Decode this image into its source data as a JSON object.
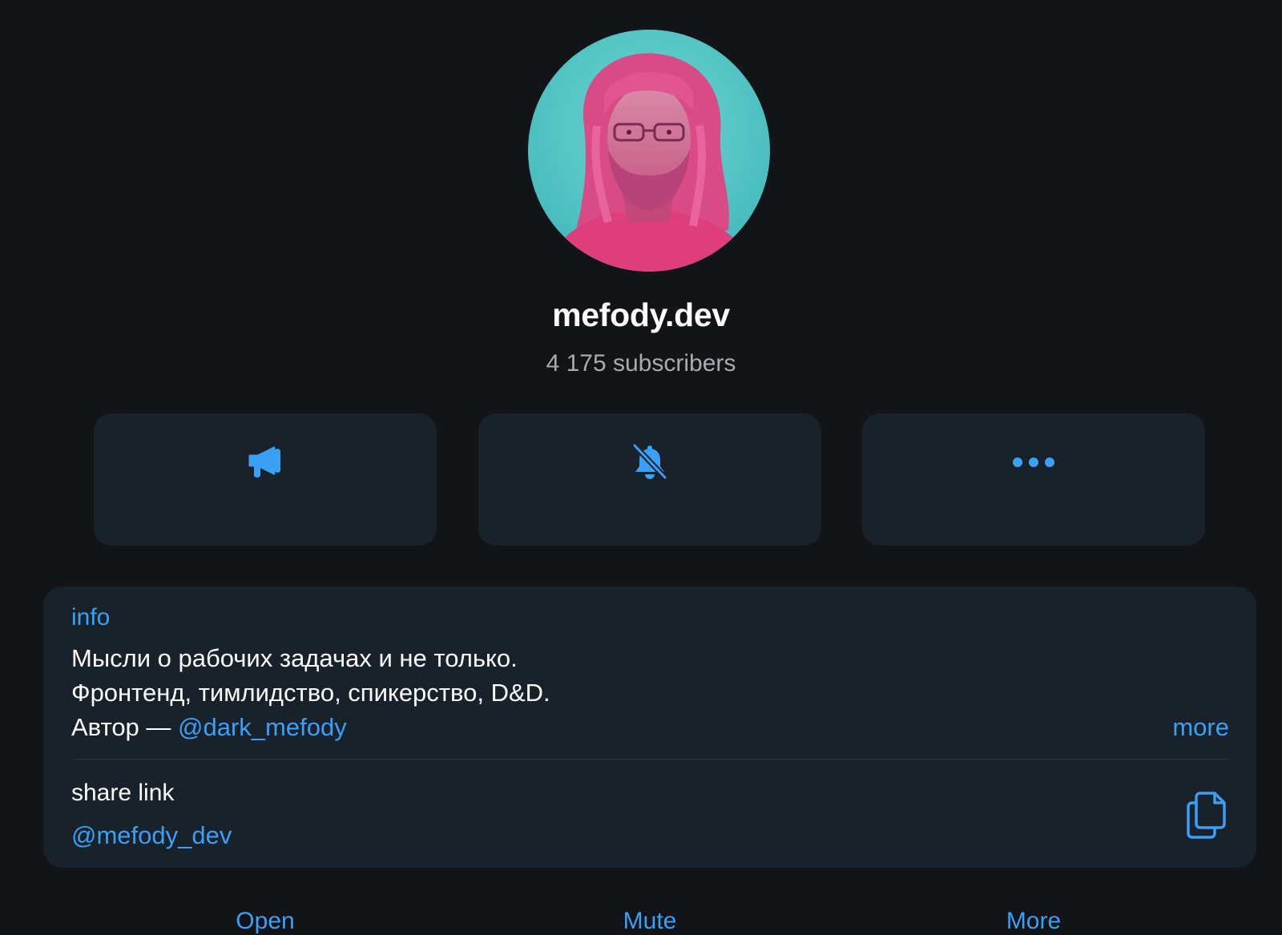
{
  "channel": {
    "name": "mefody.dev",
    "subscribers": "4 175 subscribers"
  },
  "actions": [
    {
      "label": "Open",
      "icon": "megaphone-icon"
    },
    {
      "label": "Mute",
      "icon": "bell-slash-icon"
    },
    {
      "label": "More",
      "icon": "ellipsis-icon"
    }
  ],
  "info": {
    "heading": "info",
    "lines": [
      "Мысли о рабочих задачах и не только.",
      "Фронтенд, тимлидство, спикерство, D&D."
    ],
    "author_prefix": "Автор — ",
    "author_link": "@dark_mefody",
    "more_label": "more"
  },
  "share": {
    "label": "share link",
    "handle": "@mefody_dev",
    "copy_icon": "copy-icon"
  },
  "colors": {
    "background": "#131417",
    "card": "#19212b",
    "accent": "#3aa0f5",
    "secondary_text": "#a7acb3",
    "avatar_teal": "#4fc9c9",
    "avatar_pink": "#e2457f"
  }
}
